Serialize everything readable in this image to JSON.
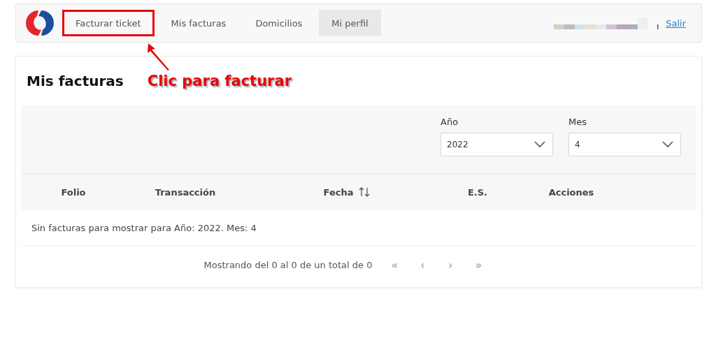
{
  "nav": {
    "items": [
      {
        "label": "Facturar ticket",
        "selected": false,
        "annotated": true
      },
      {
        "label": "Mis facturas",
        "selected": false,
        "annotated": false
      },
      {
        "label": "Domicilios",
        "selected": false,
        "annotated": false
      },
      {
        "label": "Mi perfil",
        "selected": true,
        "annotated": false
      }
    ],
    "logout": "Salir"
  },
  "page": {
    "title": "Mis facturas",
    "annotation": "Clic para facturar"
  },
  "filters": [
    {
      "label": "Año",
      "value": "2022"
    },
    {
      "label": "Mes",
      "value": "4"
    }
  ],
  "table": {
    "columns": [
      {
        "label": "Folio",
        "sortable": false
      },
      {
        "label": "Transacción",
        "sortable": false
      },
      {
        "label": "Fecha",
        "sortable": true
      },
      {
        "label": "E.S.",
        "sortable": false
      },
      {
        "label": "Acciones",
        "sortable": false
      }
    ],
    "empty_message": "Sin facturas para mostrar para Año: 2022. Mes: 4"
  },
  "pagination": {
    "summary": "Mostrando del 0 al 0 de un total de 0",
    "buttons": [
      "«",
      "‹",
      "›",
      "»"
    ]
  }
}
